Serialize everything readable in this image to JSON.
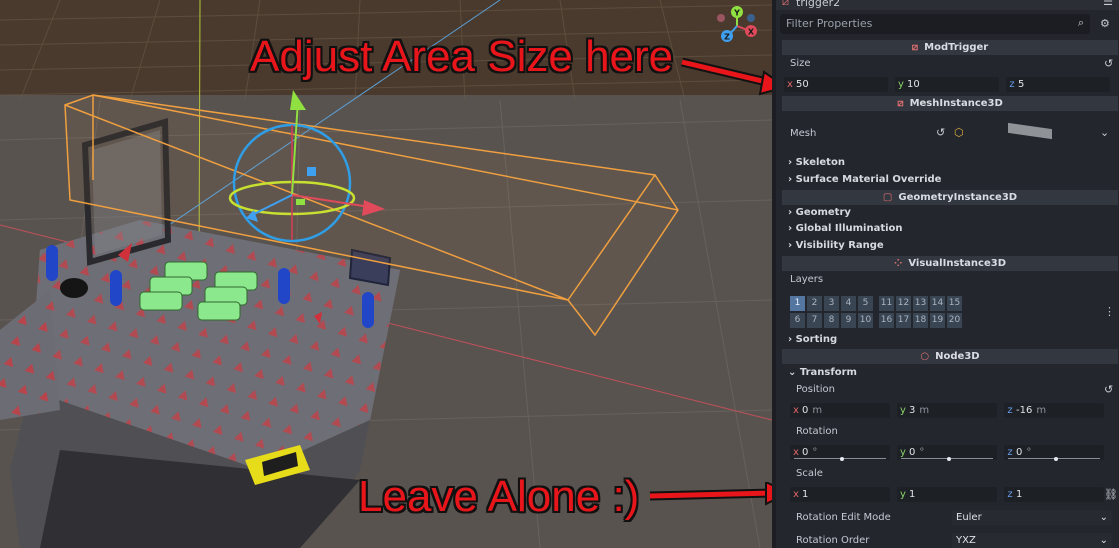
{
  "annotations": {
    "adjust": "Adjust Area Size here",
    "leave": "Leave Alone :)"
  },
  "inspector": {
    "node_name": "trigger2",
    "filter_placeholder": "Filter Properties",
    "mod_trigger": {
      "header": "ModTrigger",
      "size_label": "Size",
      "size": {
        "x": "50",
        "y": "10",
        "z": "5"
      }
    },
    "mesh_instance": {
      "header": "MeshInstance3D",
      "mesh_label": "Mesh",
      "skeleton": "Skeleton",
      "surface_material_override": "Surface Material Override"
    },
    "geometry_instance": {
      "header": "GeometryInstance3D",
      "geometry": "Geometry",
      "global_illumination": "Global Illumination",
      "visibility_range": "Visibility Range"
    },
    "visual_instance": {
      "header": "VisualInstance3D",
      "layers_label": "Layers",
      "layers_row1": [
        "1",
        "2",
        "3",
        "4",
        "5",
        "11",
        "12",
        "13",
        "14",
        "15"
      ],
      "layers_row2": [
        "6",
        "7",
        "8",
        "9",
        "10",
        "16",
        "17",
        "18",
        "19",
        "20"
      ],
      "sorting": "Sorting"
    },
    "node3d": {
      "header": "Node3D",
      "transform": "Transform",
      "position_label": "Position",
      "position": {
        "x": "0",
        "y": "3",
        "z": "-16",
        "unit": "m"
      },
      "rotation_label": "Rotation",
      "rotation": {
        "x": "0",
        "y": "0",
        "z": "0",
        "unit": "°"
      },
      "scale_label": "Scale",
      "scale": {
        "x": "1",
        "y": "1",
        "z": "1"
      },
      "rotation_edit_mode_label": "Rotation Edit Mode",
      "rotation_edit_mode": "Euler",
      "rotation_order_label": "Rotation Order",
      "rotation_order": "YXZ"
    }
  },
  "gizmo_axes": [
    "Y",
    "X",
    "Z"
  ],
  "colors": {
    "annotation_red": "#e8161a",
    "axis_x": "#e06666",
    "axis_y": "#8bd36a",
    "axis_z": "#6a9ff0",
    "selection_orange": "#f0a040",
    "panel_bg": "#23262d"
  }
}
